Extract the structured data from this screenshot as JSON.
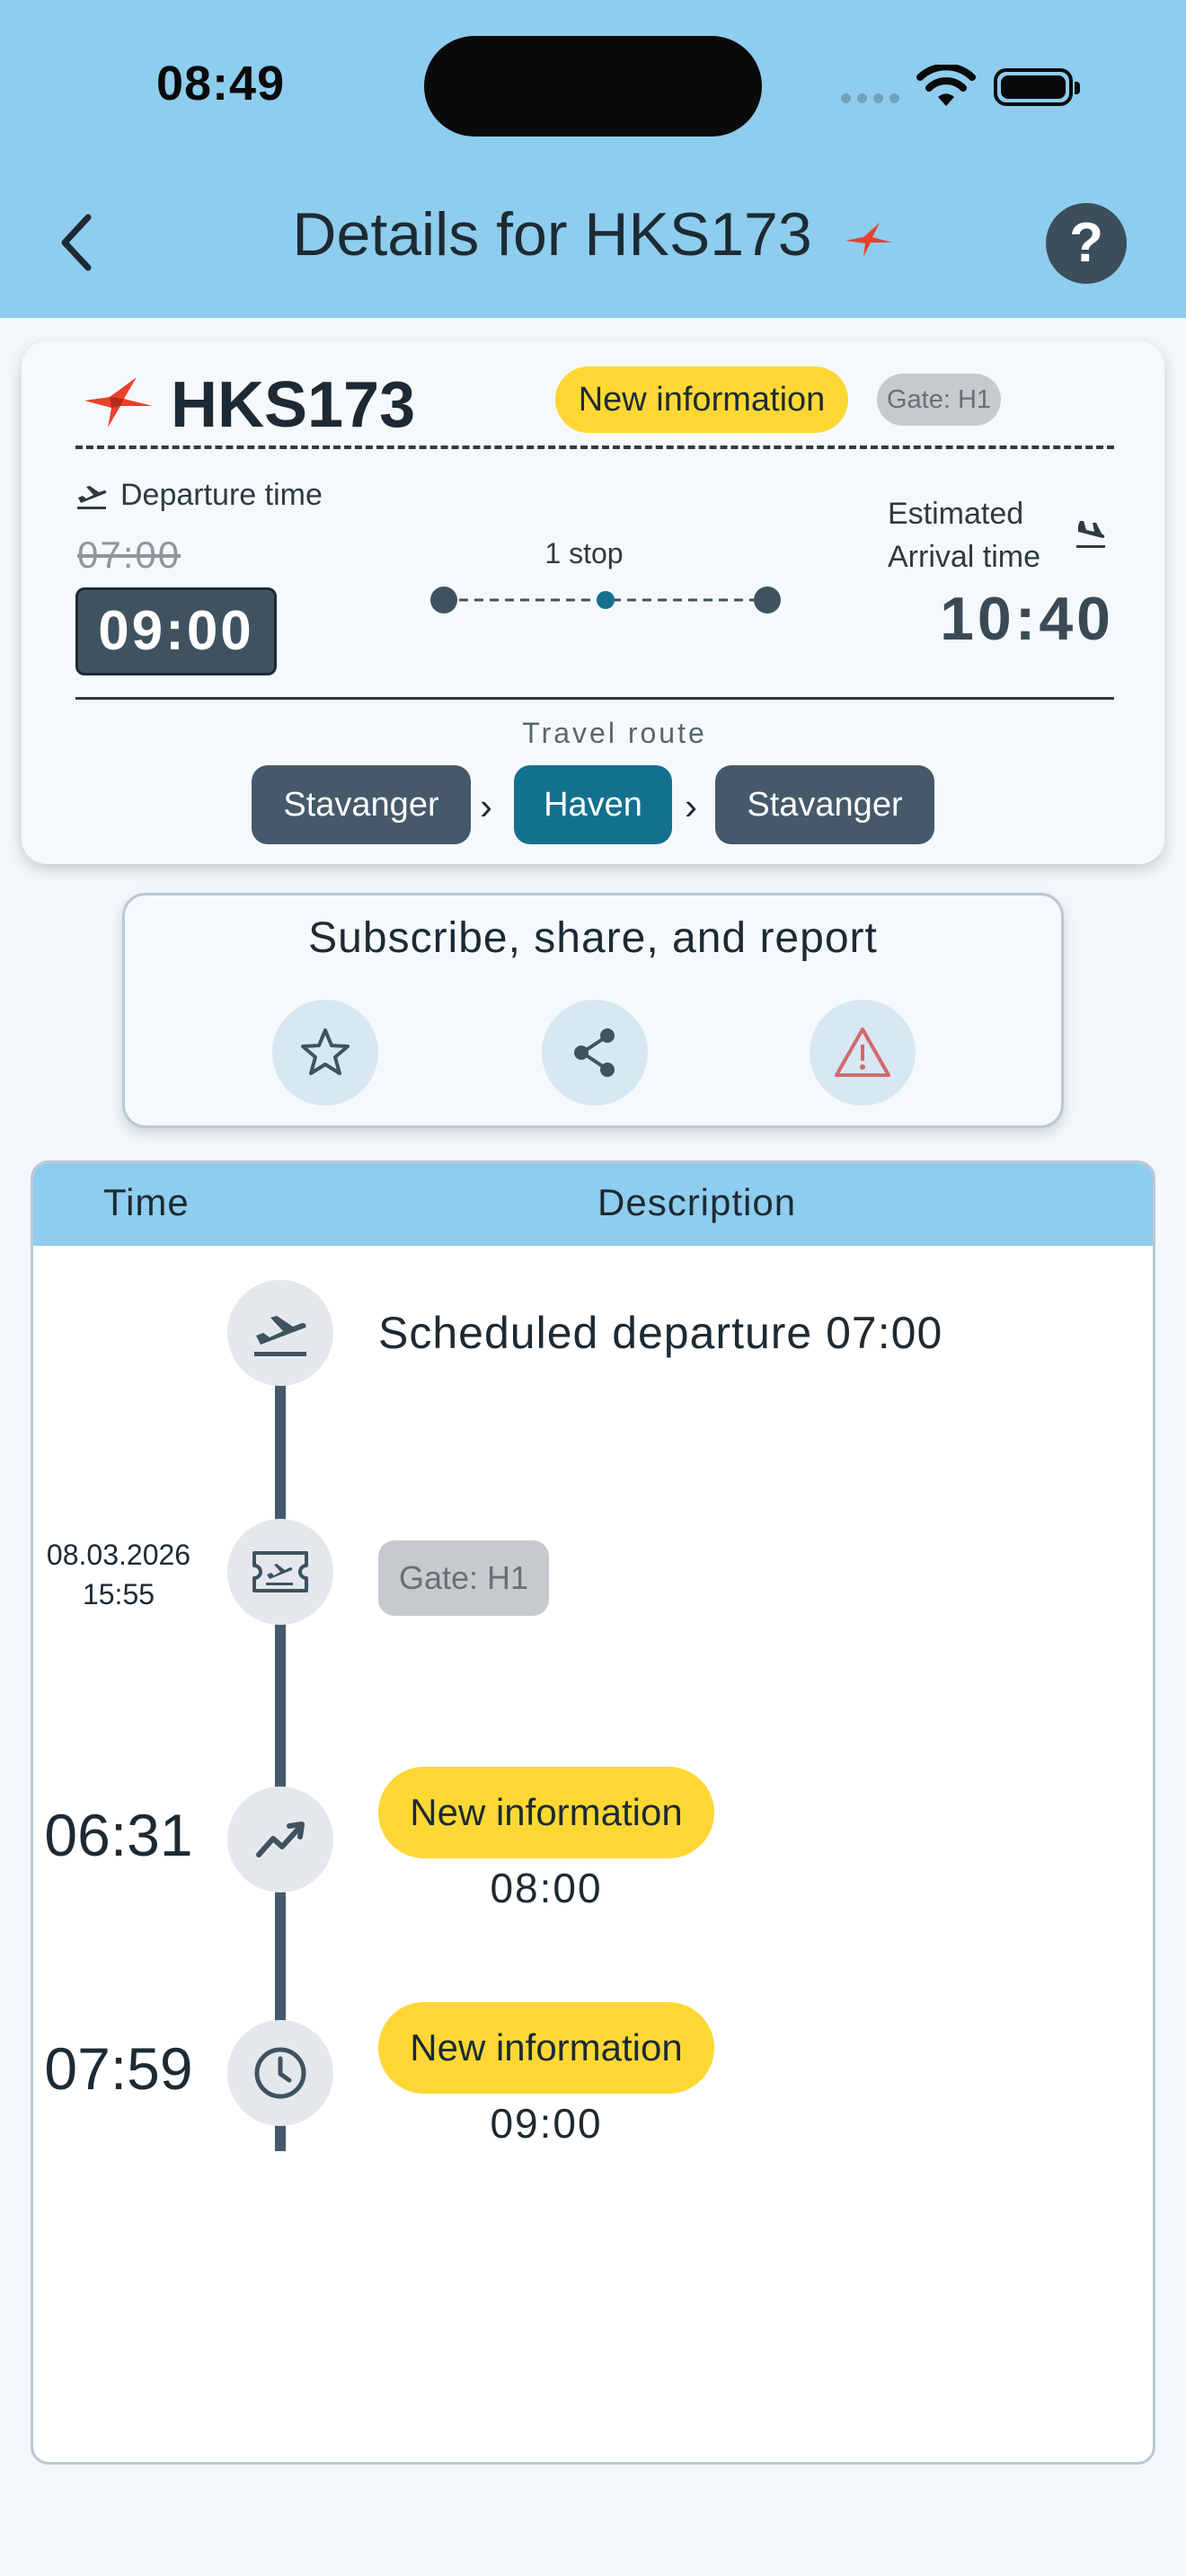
{
  "status_bar": {
    "time": "08:49"
  },
  "header": {
    "title": "Details for HKS173"
  },
  "flight_card": {
    "flight_number": "HKS173",
    "new_info_badge": "New information",
    "gate_badge": "Gate: H1",
    "departure_label": "Departure time",
    "departure_original": "07:00",
    "departure_new": "09:00",
    "stops": "1 stop",
    "arrival_label_line1": "Estimated",
    "arrival_label_line2": "Arrival time",
    "arrival_time": "10:40",
    "route_title": "Travel route",
    "route": [
      "Stavanger",
      "Haven",
      "Stavanger"
    ]
  },
  "actions": {
    "title": "Subscribe, share, and report"
  },
  "timeline": {
    "col_time": "Time",
    "col_description": "Description",
    "events": [
      {
        "time": "",
        "description": "Scheduled departure 07:00",
        "icon": "plane-departure-icon"
      },
      {
        "time_date": "08.03.2026",
        "time_clock": "15:55",
        "badge": "Gate: H1",
        "icon": "boarding-pass-icon"
      },
      {
        "time": "06:31",
        "badge": "New information",
        "value": "08:00",
        "icon": "trending-icon"
      },
      {
        "time": "07:59",
        "badge": "New information",
        "value": "09:00",
        "icon": "clock-icon"
      }
    ]
  },
  "colors": {
    "header_bg": "#8ecdee",
    "new_info": "#fdd835",
    "gate_badge": "#c7cacd",
    "route_chip": "#46596a",
    "route_chip_active": "#13718e",
    "brand_bird": "#e8412c"
  }
}
